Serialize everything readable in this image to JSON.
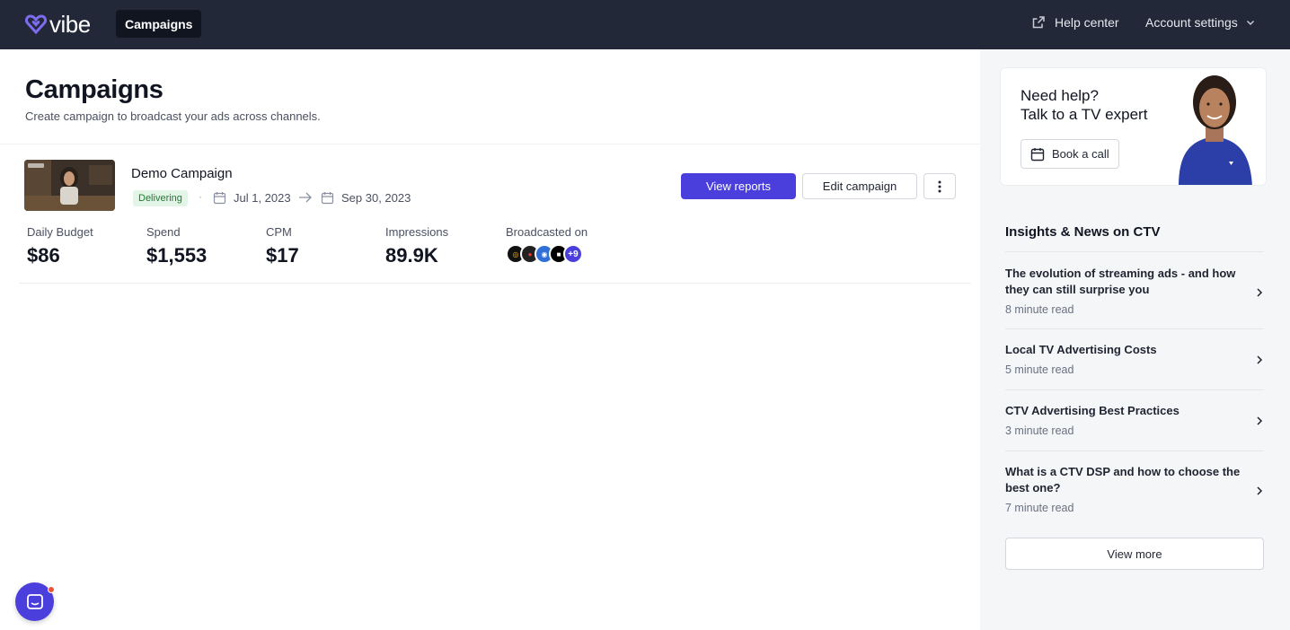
{
  "app": {
    "logo_text": "vibe",
    "nav_active": "Campaigns"
  },
  "header": {
    "help_center": "Help center",
    "account_settings": "Account settings"
  },
  "page": {
    "title": "Campaigns",
    "subtitle": "Create campaign to broadcast your ads across channels."
  },
  "campaign": {
    "name": "Demo Campaign",
    "status": "Delivering",
    "separator": "·",
    "start_date": "Jul 1, 2023",
    "end_date": "Sep 30, 2023",
    "actions": {
      "view_reports": "View reports",
      "edit_campaign": "Edit campaign"
    },
    "metrics": {
      "daily_budget_label": "Daily Budget",
      "daily_budget_value": "$86",
      "spend_label": "Spend",
      "spend_value": "$1,553",
      "cpm_label": "CPM",
      "cpm_value": "$17",
      "impressions_label": "Impressions",
      "impressions_value": "89.9K",
      "broadcast_label": "Broadcasted on",
      "more_channels": "+9"
    }
  },
  "help_card": {
    "title_line1": "Need help?",
    "title_line2": "Talk to a TV expert",
    "book_call": "Book a call"
  },
  "insights": {
    "title": "Insights & News on CTV",
    "articles": [
      {
        "title": "The evolution of streaming ads - and how they can still surprise you",
        "meta": "8 minute read"
      },
      {
        "title": "Local TV Advertising Costs",
        "meta": "5 minute read"
      },
      {
        "title": "CTV Advertising Best Practices",
        "meta": "3 minute read"
      },
      {
        "title": "What is a CTV DSP and how to choose the best one?",
        "meta": "7 minute read"
      }
    ],
    "view_more": "View more"
  },
  "colors": {
    "topbar": "#222837",
    "primary": "#4a3fdc",
    "status_bg": "#e3f5e6",
    "status_text": "#1f7a35"
  }
}
